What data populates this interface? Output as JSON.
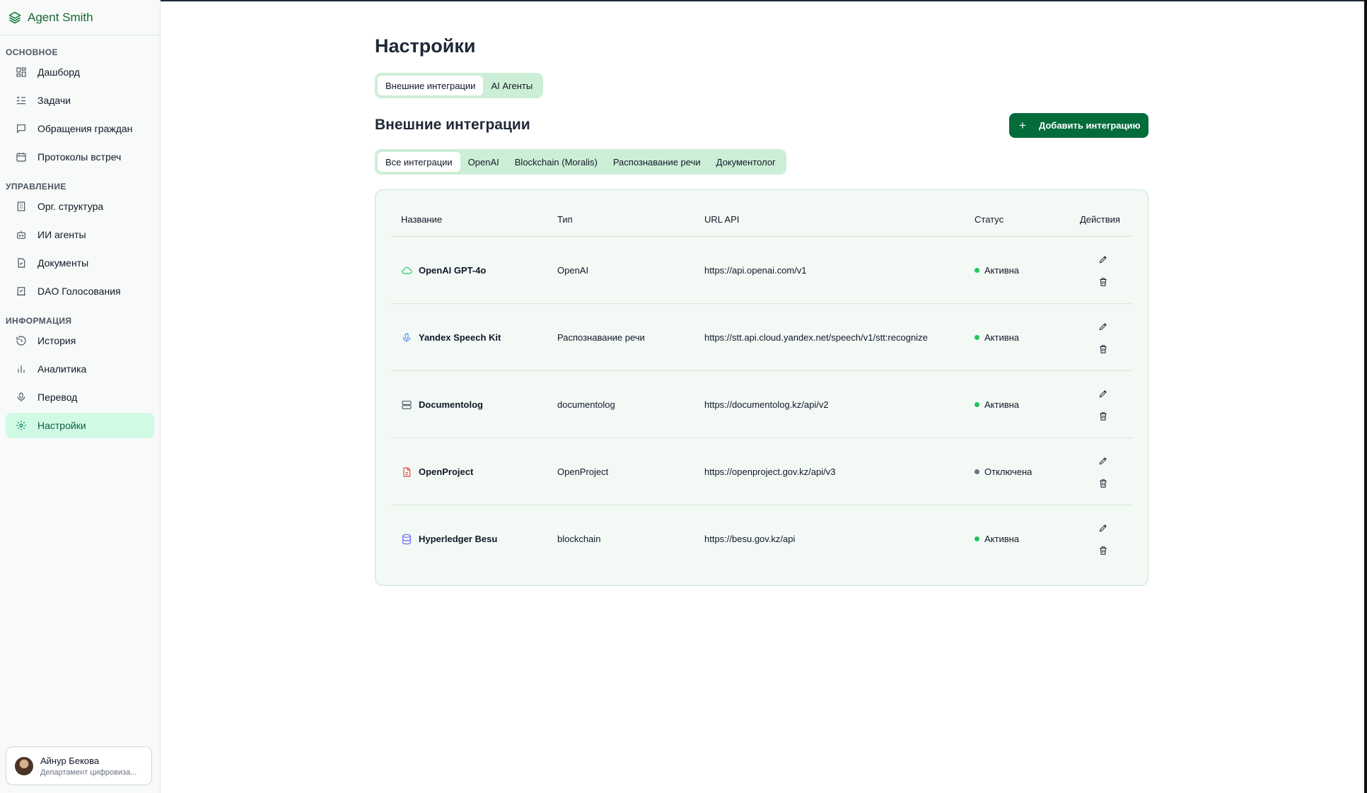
{
  "app": {
    "name": "Agent Smith"
  },
  "sidebar": {
    "sections": [
      {
        "title": "ОСНОВНОЕ",
        "items": [
          {
            "label": "Дашборд",
            "icon": "dashboard-icon"
          },
          {
            "label": "Задачи",
            "icon": "list-check-icon"
          },
          {
            "label": "Обращения граждан",
            "icon": "message-icon"
          },
          {
            "label": "Протоколы встреч",
            "icon": "calendar-icon"
          }
        ]
      },
      {
        "title": "УПРАВЛЕНИЕ",
        "items": [
          {
            "label": "Орг. структура",
            "icon": "building-icon"
          },
          {
            "label": "ИИ агенты",
            "icon": "bot-icon"
          },
          {
            "label": "Документы",
            "icon": "document-icon"
          },
          {
            "label": "DAO Голосования",
            "icon": "vote-icon"
          }
        ]
      },
      {
        "title": "ИНФОРМАЦИЯ",
        "items": [
          {
            "label": "История",
            "icon": "history-icon"
          },
          {
            "label": "Аналитика",
            "icon": "bar-chart-icon"
          },
          {
            "label": "Перевод",
            "icon": "microphone-icon"
          },
          {
            "label": "Настройки",
            "icon": "gear-icon",
            "active": true
          }
        ]
      }
    ]
  },
  "user": {
    "name": "Айнур Бекова",
    "department": "Департамент цифровиза..."
  },
  "page": {
    "title": "Настройки"
  },
  "main_tabs": [
    "Внешние интеграции",
    "AI Агенты"
  ],
  "integrations": {
    "title": "Внешние интеграции",
    "add_button": "Добавить интеграцию",
    "filters": [
      "Все интеграции",
      "OpenAI",
      "Blockchain (Moralis)",
      "Распознавание речи",
      "Документолог"
    ],
    "columns": {
      "name": "Название",
      "type": "Тип",
      "url": "URL API",
      "status": "Статус",
      "actions": "Действия"
    },
    "rows": [
      {
        "name": "OpenAI GPT-4o",
        "type": "OpenAI",
        "url": "https://api.openai.com/v1",
        "status": "Активна",
        "icon": "cloud-icon"
      },
      {
        "name": "Yandex Speech Kit",
        "type": "Распознавание речи",
        "url": "https://stt.api.cloud.yandex.net/speech/v1/stt:recognize",
        "status": "Активна",
        "icon": "microphone-icon"
      },
      {
        "name": "Documentolog",
        "type": "documentolog",
        "url": "https://documentolog.kz/api/v2",
        "status": "Активна",
        "icon": "server-icon"
      },
      {
        "name": "OpenProject",
        "type": "OpenProject",
        "url": "https://openproject.gov.kz/api/v3",
        "status": "Отключена",
        "icon": "file-text-icon"
      },
      {
        "name": "Hyperledger Besu",
        "type": "blockchain",
        "url": "https://besu.gov.kz/api",
        "status": "Активна",
        "icon": "database-icon"
      }
    ]
  },
  "colors": {
    "accent": "#046b3b",
    "active_status": "#22c55e",
    "disabled_status": "#6b7280"
  }
}
